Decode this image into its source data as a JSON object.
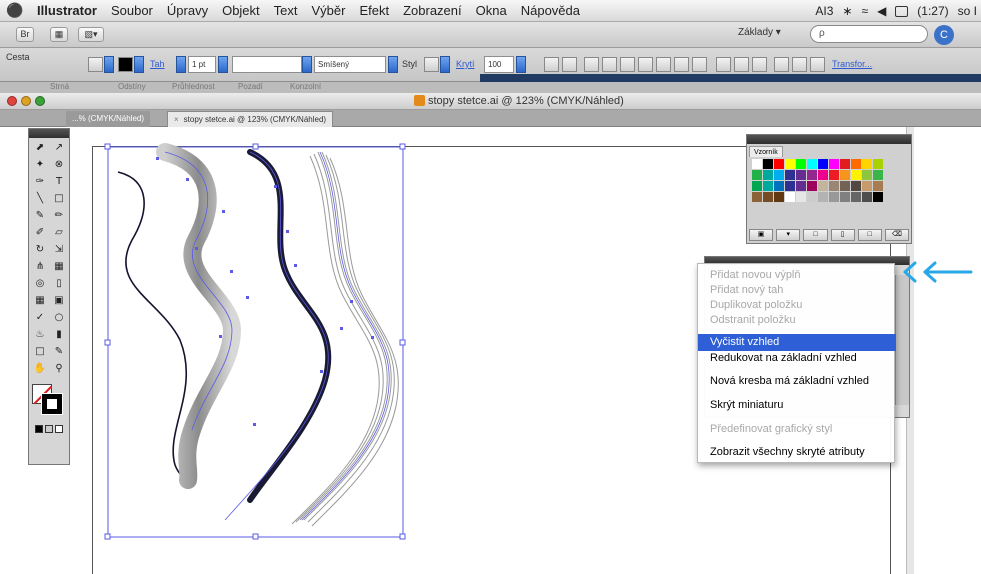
{
  "menubar": {
    "app_name": "Illustrator",
    "items": [
      "Soubor",
      "Úpravy",
      "Objekt",
      "Text",
      "Výběr",
      "Efekt",
      "Zobrazení",
      "Okna",
      "Nápověda"
    ],
    "status_text": "(1:27)",
    "status_tail": "so I",
    "status_badge": "AI3"
  },
  "appbar": {
    "workspace_label": "Základy ▾",
    "search_placeholder": "ρ"
  },
  "control_bar": {
    "selection_label": "Cesta",
    "stroke_label": "Tah",
    "stroke_weight": "1 pt",
    "blend_value": "Smíšený",
    "style_label": "Styl",
    "opacity_label": "Krytí",
    "opacity_value": "100",
    "transform_link": "Transfor..."
  },
  "panel_strip": {
    "items": [
      "Strná",
      "Odstíny",
      "Průhlednost",
      "Pozadí",
      "Konzolní"
    ]
  },
  "document": {
    "window_title": "stopy stetce.ai @ 123% (CMYK/Náhled)",
    "tabs": [
      {
        "label": "...% (CMYK/Náhled)",
        "active": false
      },
      {
        "label": "stopy stetce.ai @ 123% (CMYK/Náhled)",
        "active": true
      }
    ]
  },
  "swatches_panel": {
    "title": "Vzorník",
    "colors": [
      "#ffffff",
      "#000000",
      "#ff0000",
      "#ffff00",
      "#00ff00",
      "#00ffff",
      "#0000ff",
      "#ff00ff",
      "#e11d1d",
      "#ff6a00",
      "#ffd400",
      "#a8d200",
      "#20b14a",
      "#00a99d",
      "#00aeef",
      "#2e3192",
      "#662d91",
      "#92278f",
      "#ec008c",
      "#ed1c24",
      "#f7941d",
      "#fff200",
      "#8dc63f",
      "#39b54a",
      "#00a651",
      "#00a99d",
      "#0072bc",
      "#2e3192",
      "#662d91",
      "#9e005d",
      "#c2b59b",
      "#998675",
      "#736357",
      "#534741",
      "#c69c6d",
      "#a67c52",
      "#8c6239",
      "#754c24",
      "#603913",
      "#ffffff",
      "#e6e6e6",
      "#cccccc",
      "#b3b3b3",
      "#999999",
      "#808080",
      "#666666",
      "#4d4d4d",
      "#000000"
    ]
  },
  "context_menu": {
    "items": [
      {
        "label": "Přidat novou výplň",
        "enabled": false,
        "selected": false
      },
      {
        "label": "Přidat nový tah",
        "enabled": false,
        "selected": false
      },
      {
        "label": "Duplikovat položku",
        "enabled": false,
        "selected": false
      },
      {
        "label": "Odstranit položku",
        "enabled": false,
        "selected": false
      },
      {
        "label": "Vyčistit vzhled",
        "enabled": true,
        "selected": true
      },
      {
        "label": "Redukovat na základní vzhled",
        "enabled": true,
        "selected": false
      },
      {
        "label": "Nová kresba má základní vzhled",
        "enabled": true,
        "selected": false
      },
      {
        "label": "Skrýt miniaturu",
        "enabled": true,
        "selected": false
      },
      {
        "label": "Předefinovat grafický styl",
        "enabled": false,
        "selected": false
      },
      {
        "label": "Zobrazit všechny skryté atributy",
        "enabled": true,
        "selected": false
      }
    ]
  },
  "colors": {
    "menu_highlight": "#2e5fd6",
    "annotation_arrow": "#2aa7e6",
    "path_selection": "#5a5ae6",
    "dark_stroke": "#14142e"
  },
  "icons": {
    "apple": "apple-icon",
    "annotation": "double-arrow-left-icon"
  }
}
